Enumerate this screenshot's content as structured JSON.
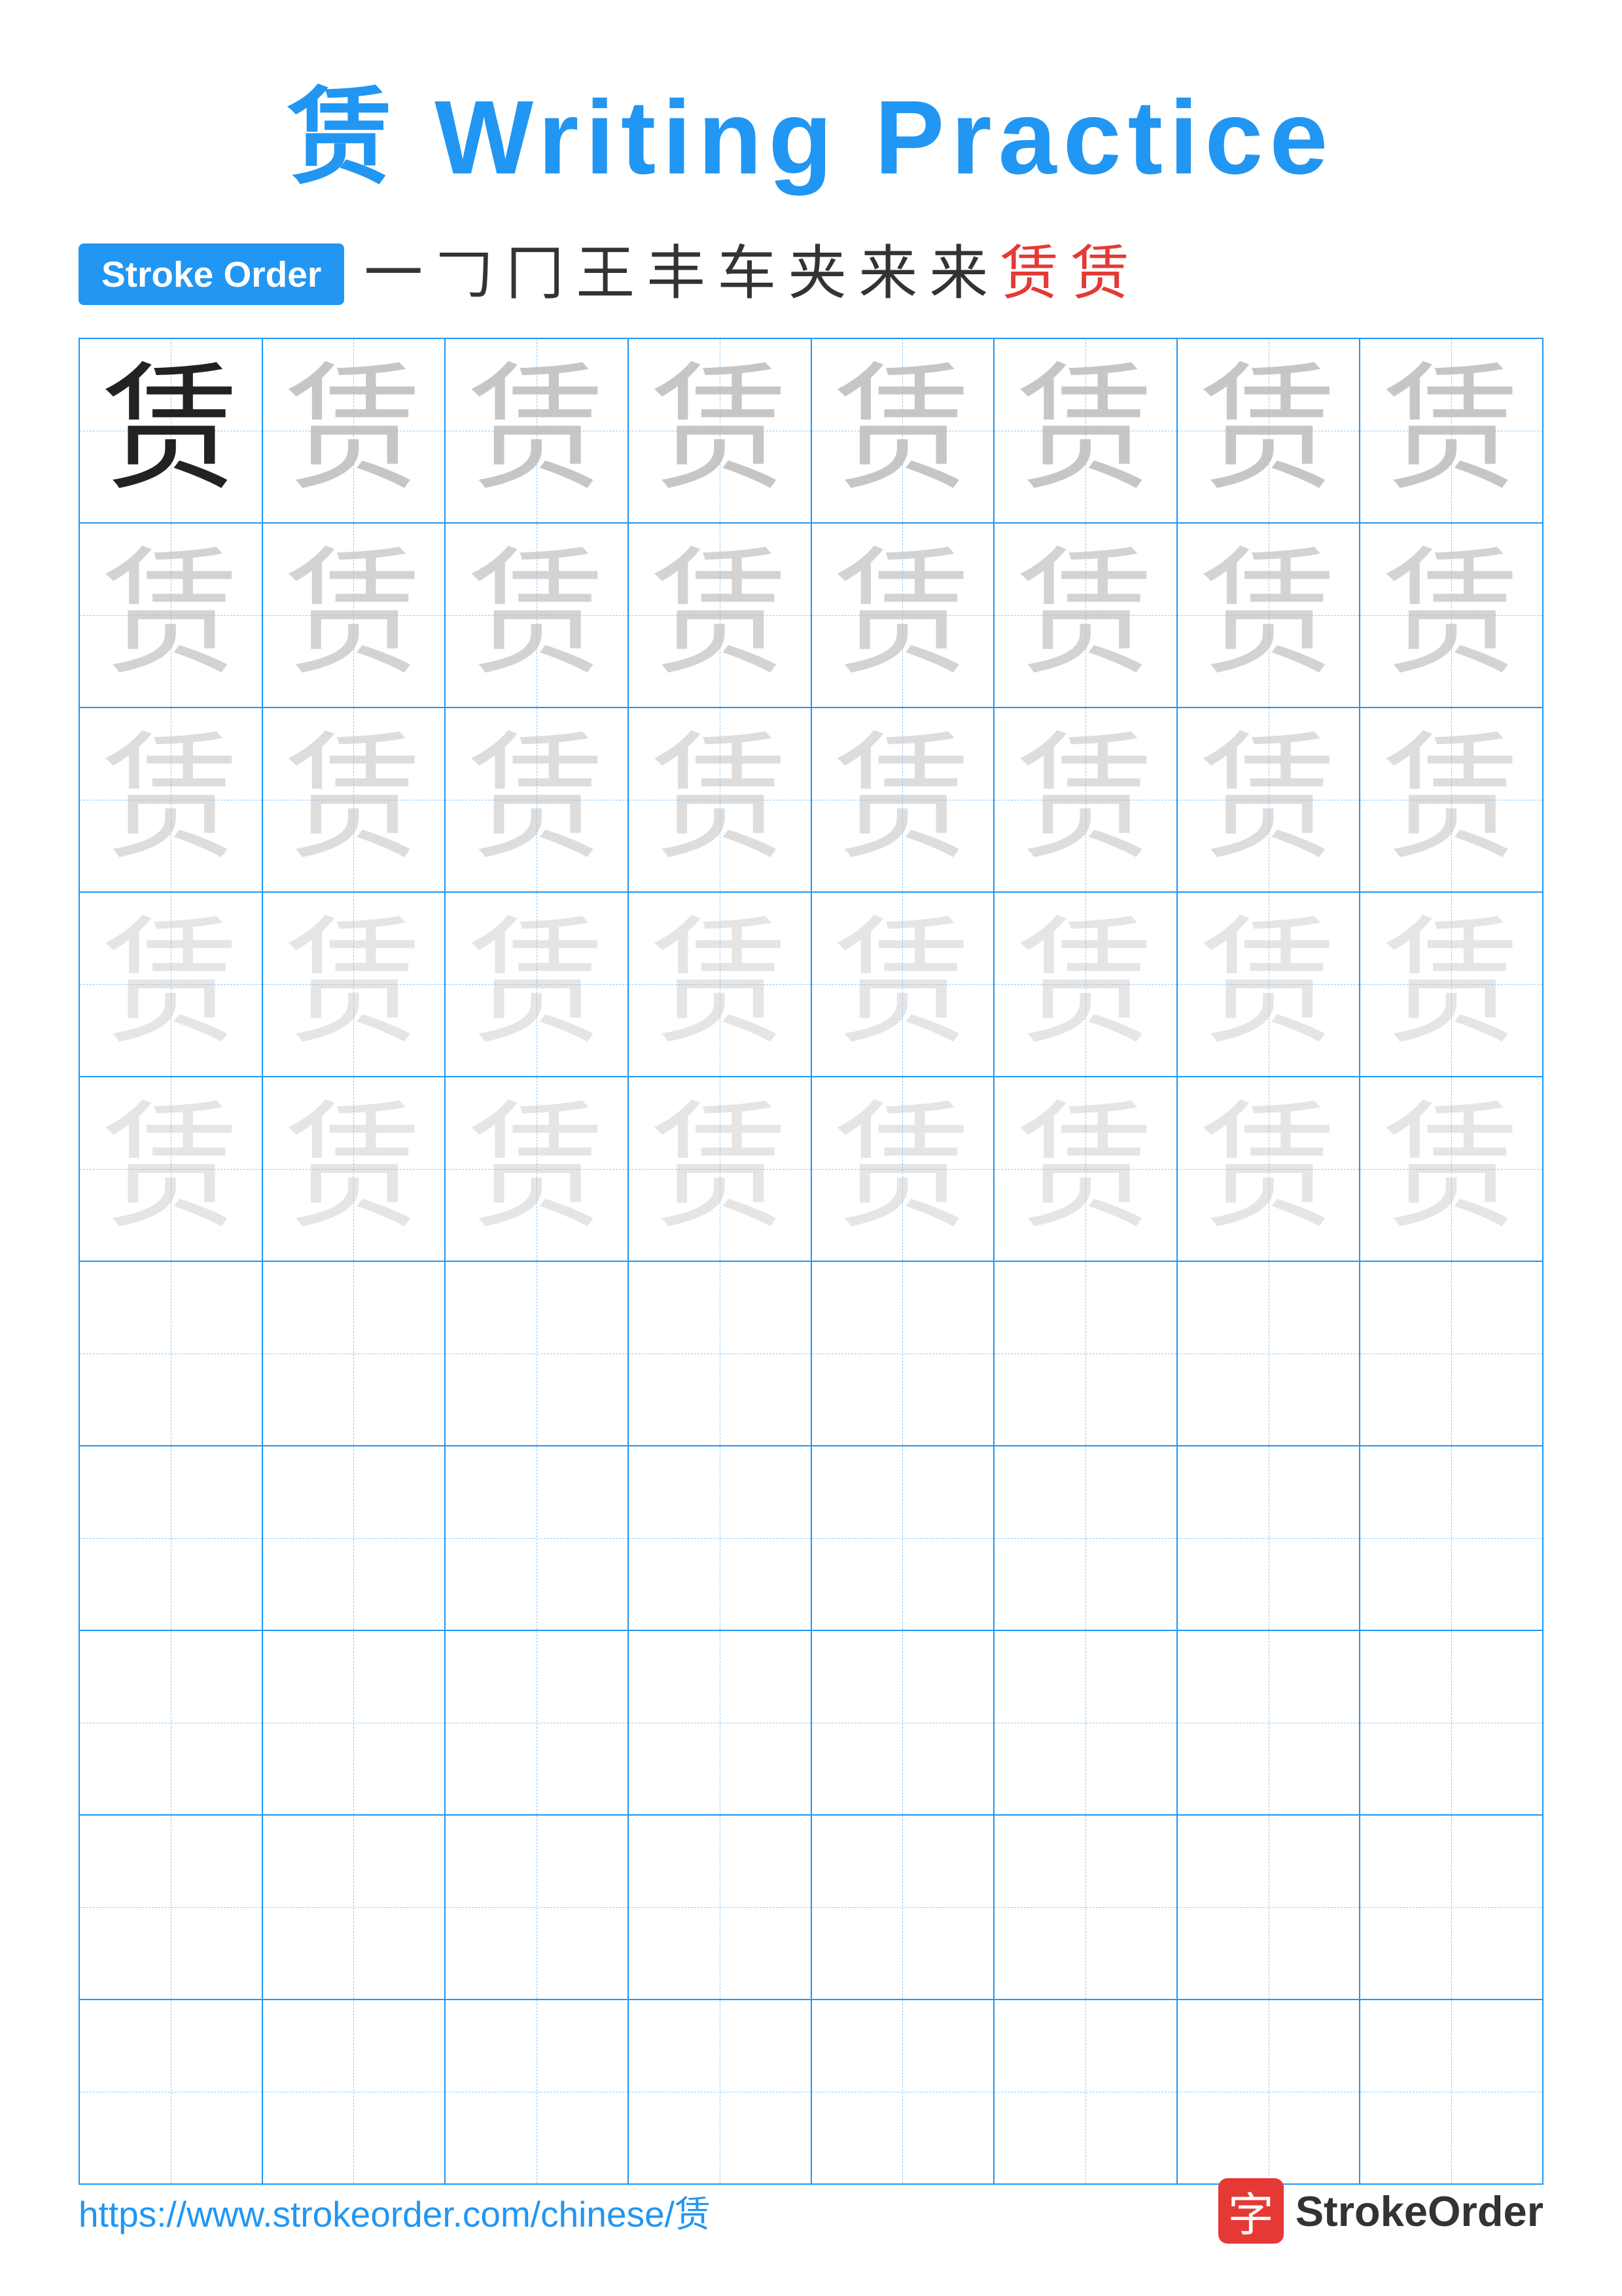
{
  "page": {
    "title": "赁 Writing Practice",
    "title_char": "赁",
    "title_text": "Writing Practice",
    "stroke_order_label": "Stroke Order",
    "stroke_chars": [
      "一",
      "𠃌",
      "冂",
      "王",
      "丰",
      "车",
      "夹",
      "来",
      "来",
      "赁",
      "赁"
    ],
    "stroke_chars_colored": [
      false,
      false,
      false,
      false,
      false,
      false,
      false,
      false,
      false,
      true,
      true
    ],
    "practice_char": "赁",
    "rows": 10,
    "cols": 8,
    "footer_url": "https://www.strokeorder.com/chinese/赁",
    "footer_logo_char": "字",
    "footer_logo_name": "StrokeOrder"
  }
}
